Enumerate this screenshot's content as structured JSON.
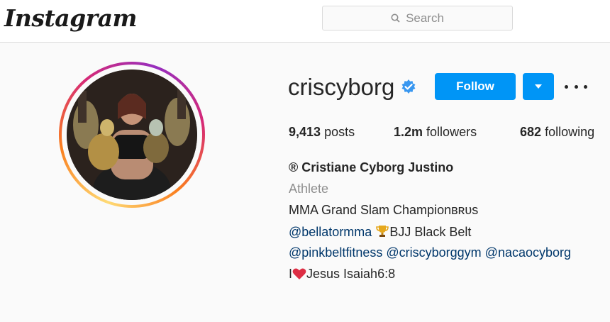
{
  "header": {
    "logo_text": "Instagram",
    "search_placeholder": "Search"
  },
  "profile": {
    "username": "criscyborg",
    "verified": true,
    "follow_label": "Follow",
    "stats": {
      "posts_count": "9,413",
      "posts_label": "posts",
      "followers_count": "1.2m",
      "followers_label": "followers",
      "following_count": "682",
      "following_label": "following"
    },
    "bio": {
      "name": "® Cristiane Cyborg Justino",
      "category": "Athlete",
      "line1": "MMA Grand Slam Championʙʀᴜs",
      "line2_link": "@bellatormma",
      "line2_text": "BJJ Black Belt",
      "line3_links": [
        "@pinkbeltfitness",
        "@criscyborggym",
        "@nacaocyborg"
      ],
      "line4_prefix": "I",
      "line4_text": "Jesus Isaiah6:8"
    }
  },
  "colors": {
    "accent": "#0095f6",
    "verified": "#3897f0",
    "link": "#00376b"
  },
  "icons": [
    "search-icon",
    "verified-badge-icon",
    "chevron-down-icon",
    "more-options-icon",
    "trophy-icon",
    "heart-icon"
  ]
}
